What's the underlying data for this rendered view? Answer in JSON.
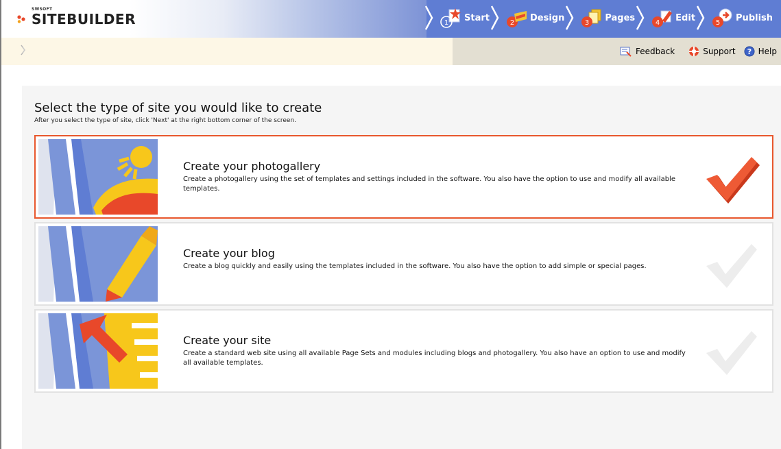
{
  "app": {
    "vendor": "SWSOFT",
    "name": "SITEBUILDER"
  },
  "steps": [
    {
      "number": "1",
      "label": "Start",
      "icon": "start-icon"
    },
    {
      "number": "2",
      "label": "Design",
      "icon": "design-icon"
    },
    {
      "number": "3",
      "label": "Pages",
      "icon": "pages-icon"
    },
    {
      "number": "4",
      "label": "Edit",
      "icon": "edit-icon"
    },
    {
      "number": "5",
      "label": "Publish",
      "icon": "publish-icon"
    }
  ],
  "toolbar": {
    "feedback_label": "Feedback",
    "support_label": "Support",
    "help_label": "Help"
  },
  "main": {
    "heading": "Select the type of site you would like to create",
    "subheading": "After you select the type of site, click 'Next' at the right bottom corner of the screen.",
    "options": [
      {
        "title": "Create your photogallery",
        "description": "Create a photogallery using the set of templates and settings included in the software. You also have the option to use and modify all available templates.",
        "selected": true
      },
      {
        "title": "Create your blog",
        "description": "Create a blog quickly and easily using the templates included in the software. You also have the option to add simple or special pages.",
        "selected": false
      },
      {
        "title": "Create your site",
        "description": "Create a standard web site using all available Page Sets and modules including blogs and photogallery. You also have an option to use and modify all available templates.",
        "selected": false
      }
    ]
  },
  "colors": {
    "selected_border": "#e8572d",
    "step_bar": "#5f7dd3",
    "toolbar_bg": "#fdf7e6",
    "checkmark_active": "#e8482a",
    "checkmark_inactive": "#ececec"
  }
}
